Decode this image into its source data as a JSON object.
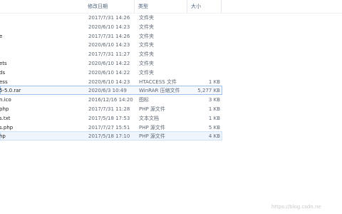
{
  "columns": {
    "date": "修改日期",
    "type": "类型",
    "size": "大小"
  },
  "files": [
    {
      "name": "",
      "date": "2017/7/31 14:26",
      "type": "文件夹",
      "size": ""
    },
    {
      "name": "",
      "date": "2020/6/10 14:23",
      "type": "文件夹",
      "size": ""
    },
    {
      "name": "e",
      "date": "2017/7/31 14:26",
      "type": "文件夹",
      "size": ""
    },
    {
      "name": "",
      "date": "2020/6/10 14:23",
      "type": "文件夹",
      "size": ""
    },
    {
      "name": "",
      "date": "2017/7/31 11:27",
      "type": "文件夹",
      "size": ""
    },
    {
      "name": "ets",
      "date": "2020/6/10 14:22",
      "type": "文件夹",
      "size": ""
    },
    {
      "name": "ds",
      "date": "2020/6/10 14:22",
      "type": "文件夹",
      "size": ""
    },
    {
      "name": "ess",
      "date": "2020/6/10 14:23",
      "type": "HTACCESS 文件",
      "size": "1 KB"
    },
    {
      "name": "5-5.0.rar",
      "date": "2020/6/3 10:49",
      "type": "WinRAR 压缩文件",
      "size": "5,277 KB"
    },
    {
      "name": "n.ico",
      "date": "2016/12/16 14:20",
      "type": "图标",
      "size": "3 KB"
    },
    {
      "name": "php",
      "date": "2017/7/31 11:28",
      "type": "PHP 源文件",
      "size": "1 KB"
    },
    {
      "name": "s.txt",
      "date": "2017/5/18 17:53",
      "type": "文本文档",
      "size": "1 KB"
    },
    {
      "name": "s.php",
      "date": "2017/7/27 15:51",
      "type": "PHP 源文件",
      "size": "5 KB"
    },
    {
      "name": "hp",
      "date": "2017/5/18 17:10",
      "type": "PHP 源文件",
      "size": "4 KB"
    }
  ],
  "watermark": "https://blog.csdn.ne"
}
